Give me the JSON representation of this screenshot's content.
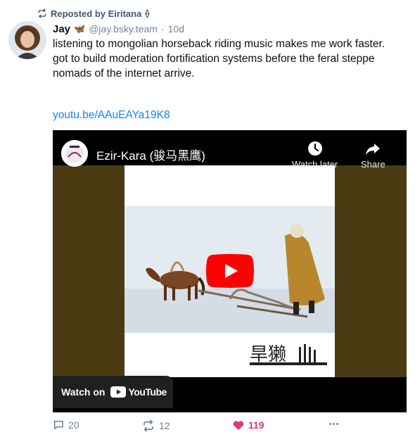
{
  "repost_bar": {
    "text": "Reposted by Eiritana",
    "badge_glyph": "⟠"
  },
  "post": {
    "author_name": "Jay",
    "author_emoji": "🦋",
    "handle": "@jay.bsky.team",
    "separator": "·",
    "time": "10d",
    "lines": [
      "listening to mongolian horseback riding music makes me work faster.",
      "got to build moderation fortification systems before the feral steppe nomads of the internet arrive."
    ],
    "link": "youtu.be/AAuEAYa19K8"
  },
  "video": {
    "title": "Ezir-Kara (骏马黑鹰)",
    "watch_later": "Watch later",
    "share": "Share",
    "watch_on": "Watch on",
    "youtube": "YouTube",
    "thumb_caption": "旱獭"
  },
  "actions": {
    "replies": "20",
    "reposts": "12",
    "likes": "119",
    "more": "•••"
  },
  "colors": {
    "accent_blue": "#1083fe",
    "like_pink": "#d93981",
    "muted": "#6f869f",
    "dark_bg": "#4a3b13"
  }
}
